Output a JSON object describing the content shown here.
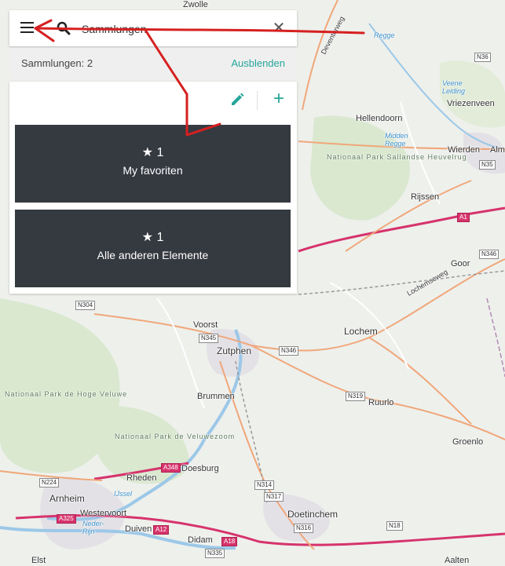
{
  "search": {
    "value": "Sammlungen"
  },
  "summary": {
    "count_label": "Sammlungen: 2",
    "hide_label": "Ausblenden"
  },
  "collections": [
    {
      "count": "1",
      "title": "My favoriten"
    },
    {
      "count": "1",
      "title": "Alle anderen Elemente"
    }
  ],
  "icons": {
    "menu": "menu-icon",
    "search": "search-icon",
    "clear": "close-icon",
    "edit": "pencil-icon",
    "add": "plus-icon",
    "star": "star-icon"
  },
  "colors": {
    "accent": "#26a69a",
    "card_bg": "#353940",
    "annotation": "#d62020",
    "highway": "#d6336c"
  },
  "map": {
    "places": {
      "zwolle": "Zwolle",
      "hellendoorn": "Hellendoorn",
      "vriezenveen": "Vriezenveen",
      "wierden": "Wierden",
      "almelo": "Alm",
      "rijssen": "Rijssen",
      "goor": "Goor",
      "lochem": "Lochem",
      "voorst": "Voorst",
      "zutphen": "Zutphen",
      "brummen": "Brummen",
      "ruurlo": "Ruurlo",
      "groenlo": "Groenlo",
      "doesburg": "Doesburg",
      "rheden": "Rheden",
      "arnheim": "Arnheim",
      "westervoort": "Westervoort",
      "duiven": "Duiven",
      "doetinchem": "Doetinchem",
      "didam": "Didam",
      "elst": "Elst",
      "aalten": "Aalten"
    },
    "parks": {
      "sallandse": "Nationaal Park Sallandse Heuvelrug",
      "hoge_veluwe": "Nationaal Park de Hoge Veluwe",
      "veluwezoom": "Nationaal Park de Veluwezoom"
    },
    "water": {
      "regge": "Regge",
      "veene_leiding": "Veene Leiding",
      "midden_regge": "Midden Regge",
      "ijssel": "IJssel",
      "neder_rijn": "Neder-Rijn"
    },
    "roads": {
      "deventerweg": "Deventerweg",
      "lochemseweg": "Lochemseweg"
    },
    "shields": {
      "n36": "N36",
      "n35": "N35",
      "a1": "A1",
      "n346a": "N346",
      "n304": "N304",
      "n345": "N345",
      "n346b": "N346",
      "n319": "N319",
      "n224": "N224",
      "a348": "A348",
      "n314": "N314",
      "n317": "N317",
      "a325": "A325",
      "a12": "A12",
      "n316": "N316",
      "a18": "A18",
      "n335": "N335",
      "n18": "N18"
    }
  }
}
